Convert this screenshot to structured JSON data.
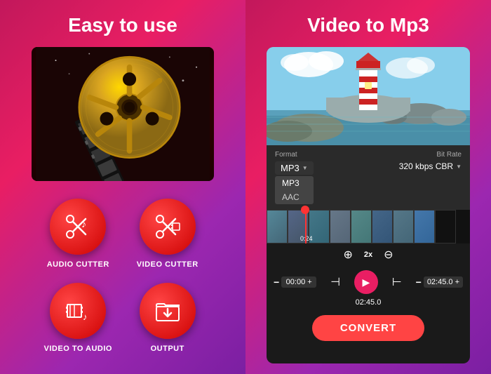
{
  "left": {
    "title": "Easy to use",
    "buttons": [
      {
        "id": "audio-cutter",
        "label": "AUDIO CUTTER",
        "icon": "scissors-music"
      },
      {
        "id": "video-cutter",
        "label": "VIDEO CUTTER",
        "icon": "scissors-film"
      },
      {
        "id": "video-to-audio",
        "label": "VIDEO TO AUDIO",
        "icon": "film-music"
      },
      {
        "id": "output",
        "label": "OUTPUT",
        "icon": "download"
      }
    ]
  },
  "right": {
    "title": "Video to Mp3",
    "format_label": "Format",
    "format_value": "MP3",
    "format_options": [
      "MP3",
      "AAC"
    ],
    "bitrate_label": "Bit Rate",
    "bitrate_value": "320 kbps CBR",
    "timeline_time": "0:24",
    "start_time": "00:00 +",
    "end_time": "02:45.0 +",
    "total_time": "02:45.0",
    "zoom_label": "2x",
    "convert_label": "CONVERT"
  }
}
